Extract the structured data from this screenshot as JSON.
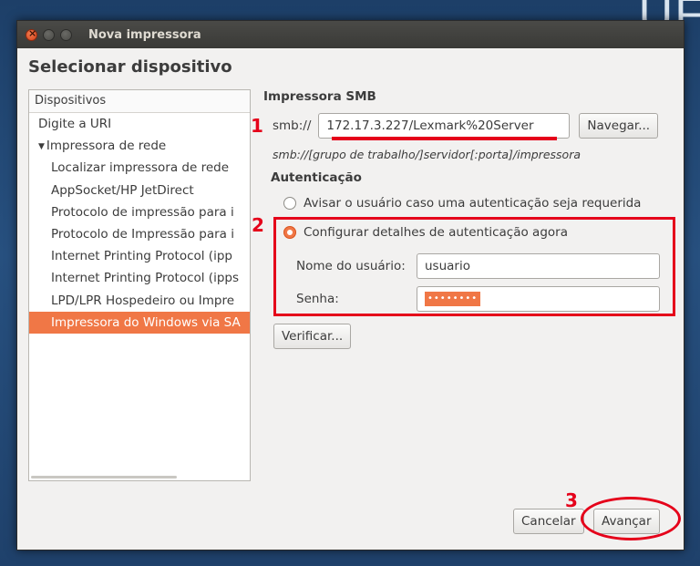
{
  "background": {
    "partial_text": "UF"
  },
  "window": {
    "title": "Nova impressora",
    "heading": "Selecionar dispositivo"
  },
  "device_list": {
    "header": "Dispositivos",
    "items": [
      {
        "label": "Digite a URI",
        "level": 0
      },
      {
        "label": "Impressora de rede",
        "level": 0,
        "expanded": true
      },
      {
        "label": "Localizar impressora de rede",
        "level": 1
      },
      {
        "label": "AppSocket/HP JetDirect",
        "level": 1
      },
      {
        "label": "Protocolo de impressão para i",
        "level": 1
      },
      {
        "label": "Protocolo de Impressão para i",
        "level": 1
      },
      {
        "label": "Internet Printing Protocol (ipp",
        "level": 1
      },
      {
        "label": "Internet Printing Protocol (ipps",
        "level": 1
      },
      {
        "label": "LPD/LPR Hospedeiro ou Impre",
        "level": 1
      },
      {
        "label": "Impressora do Windows via SA",
        "level": 1,
        "selected": true
      }
    ]
  },
  "smb": {
    "section_title": "Impressora SMB",
    "prefix": "smb://",
    "uri_value": "172.17.3.227/Lexmark%20Server",
    "browse_label": "Navegar...",
    "hint": "smb://[grupo de trabalho/]servidor[:porta]/impressora"
  },
  "auth": {
    "section_title": "Autenticação",
    "option_prompt": "Avisar o usuário caso uma autenticação seja requerida",
    "option_now": "Configurar detalhes de autenticação agora",
    "selected_option": "option_now",
    "username_label": "Nome do usuário:",
    "username_value": "usuario",
    "password_label": "Senha:",
    "password_mask": "••••••••"
  },
  "buttons": {
    "verify": "Verificar...",
    "cancel": "Cancelar",
    "next": "Avançar"
  },
  "annotations": {
    "color": "#e5001a",
    "labels": [
      "1",
      "2",
      "3"
    ]
  },
  "colors": {
    "accent": "#f07746",
    "titlebar": "#3e3e3b",
    "window_bg": "#f2f1f0"
  }
}
